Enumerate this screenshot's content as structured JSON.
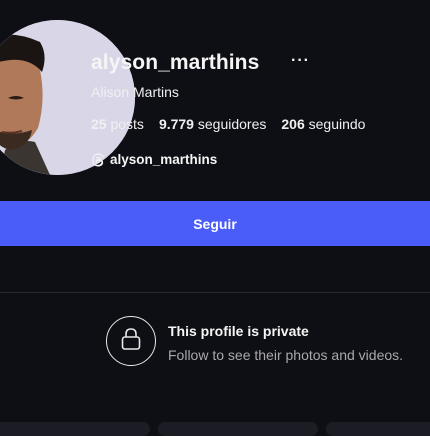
{
  "profile": {
    "username": "alyson_marthins",
    "more_label": "···",
    "full_name": "Alison Martins",
    "stats": {
      "posts_count": "25",
      "posts_label": "posts",
      "followers_count": "9.779",
      "followers_label": "seguidores",
      "following_count": "206",
      "following_label": "seguindo"
    },
    "threads_handle": "alyson_marthins"
  },
  "follow_button": {
    "label": "Seguir"
  },
  "private_notice": {
    "title": "This profile is private",
    "subtitle": "Follow to see their photos and videos."
  },
  "colors": {
    "background": "#0e0f14",
    "accent": "#4a5df9"
  }
}
